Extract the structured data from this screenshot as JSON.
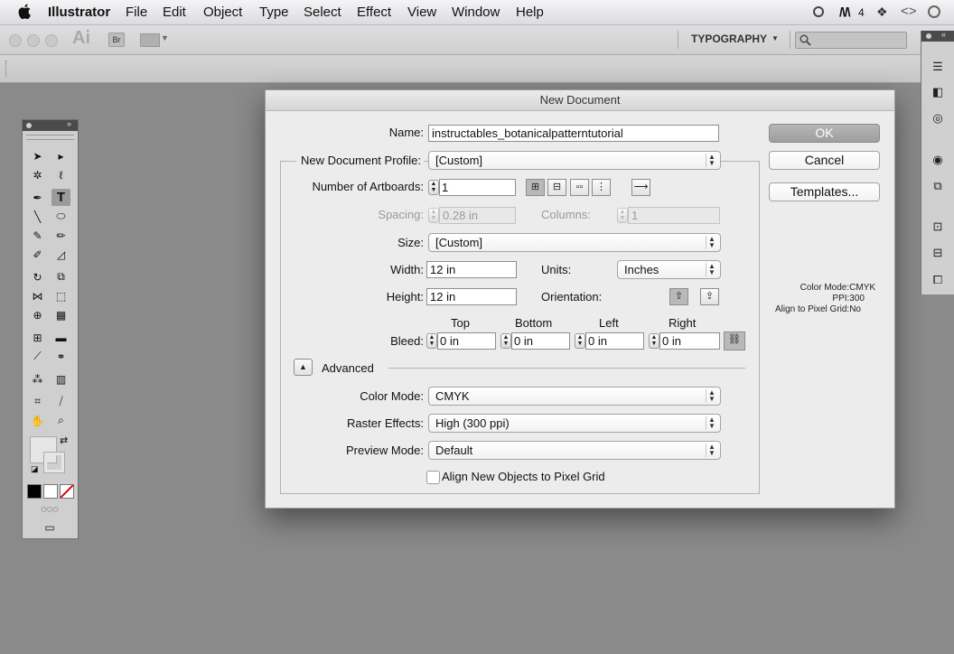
{
  "menubar": {
    "items": [
      "Illustrator",
      "File",
      "Edit",
      "Object",
      "Type",
      "Select",
      "Effect",
      "View",
      "Window",
      "Help"
    ],
    "adobe_badge": "4"
  },
  "appbar": {
    "app_logo": "Ai",
    "bridge": "Br",
    "workspace": "TYPOGRAPHY",
    "search_placeholder": ""
  },
  "dialog": {
    "title": "New Document",
    "name_label": "Name:",
    "name_value": "instructables_botanicalpatterntutorial",
    "profile_label": "New Document Profile:",
    "profile_value": "[Custom]",
    "artboards_label": "Number of Artboards:",
    "artboards_value": "1",
    "spacing_label": "Spacing:",
    "spacing_value": "0.28 in",
    "columns_label": "Columns:",
    "columns_value": "1",
    "size_label": "Size:",
    "size_value": "[Custom]",
    "width_label": "Width:",
    "width_value": "12 in",
    "units_label": "Units:",
    "units_value": "Inches",
    "height_label": "Height:",
    "height_value": "12 in",
    "orientation_label": "Orientation:",
    "bleed_label": "Bleed:",
    "bleed_headers": [
      "Top",
      "Bottom",
      "Left",
      "Right"
    ],
    "bleed_values": [
      "0 in",
      "0 in",
      "0 in",
      "0 in"
    ],
    "advanced_label": "Advanced",
    "color_mode_label": "Color Mode:",
    "color_mode_value": "CMYK",
    "raster_label": "Raster Effects:",
    "raster_value": "High (300 ppi)",
    "preview_label": "Preview Mode:",
    "preview_value": "Default",
    "pixel_grid_label": "Align New Objects to Pixel Grid",
    "pixel_grid_checked": false,
    "ok": "OK",
    "cancel": "Cancel",
    "templates": "Templates...",
    "info_lines": [
      "Color Mode:CMYK",
      "PPI:300",
      "Align to Pixel Grid:No"
    ]
  }
}
